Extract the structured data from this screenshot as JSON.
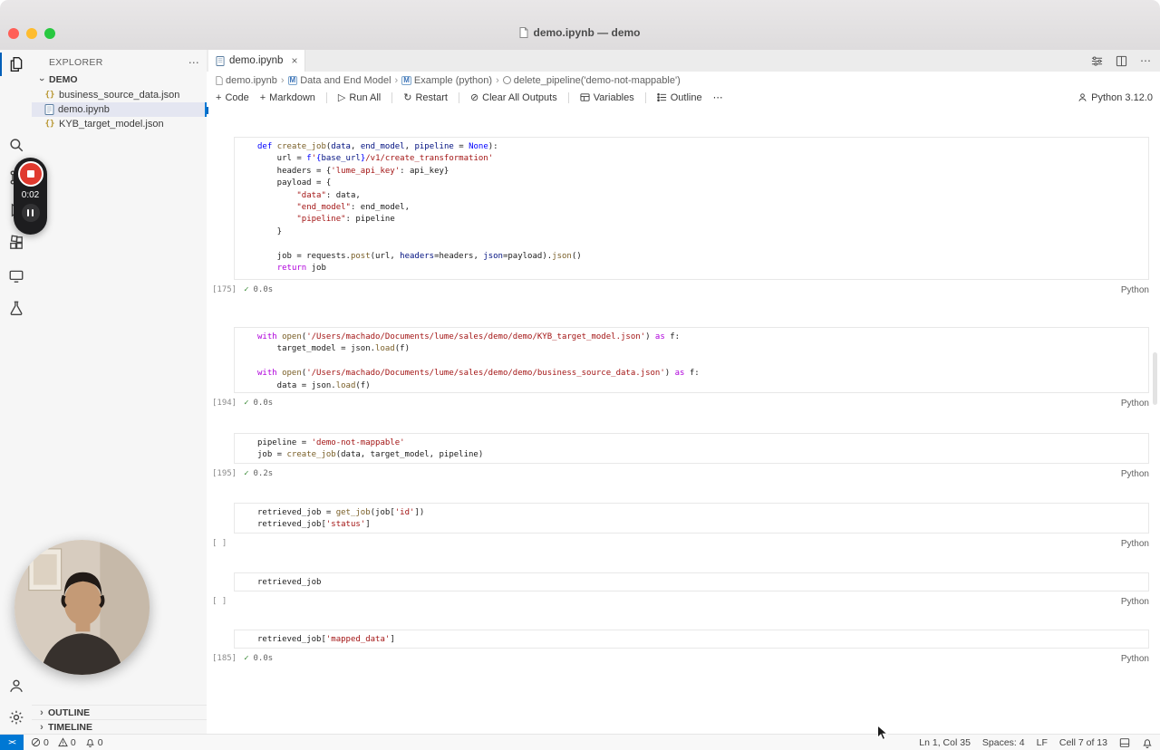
{
  "window": {
    "title": "demo.ipynb — demo"
  },
  "tab": {
    "label": "demo.ipynb",
    "close": "×"
  },
  "editor_actions": {
    "more": "⋯"
  },
  "breadcrumbs": {
    "separator": "›",
    "items": [
      {
        "label": "demo.ipynb"
      },
      {
        "label": "Data and End Model"
      },
      {
        "label": "Example (python)"
      },
      {
        "label": "delete_pipeline('demo-not-mappable')"
      }
    ]
  },
  "toolbar": {
    "code": "Code",
    "markdown": "Markdown",
    "run_all": "Run All",
    "restart": "Restart",
    "clear_outputs": "Clear All Outputs",
    "variables": "Variables",
    "outline": "Outline",
    "more": "⋯",
    "kernel": "Python 3.12.0"
  },
  "explorer": {
    "title": "EXPLORER",
    "actions": "⋯",
    "section": "DEMO",
    "files": [
      {
        "name": "business_source_data.json",
        "type": "json"
      },
      {
        "name": "demo.ipynb",
        "type": "notebook",
        "selected": true
      },
      {
        "name": "KYB_target_model.json",
        "type": "json"
      }
    ],
    "outline": "OUTLINE",
    "timeline": "TIMELINE"
  },
  "recorder": {
    "time": "0:02"
  },
  "token_colors": {
    "kw": "#0000ff",
    "ctl": "#af00db",
    "fn": "#795e26",
    "str": "#a31515",
    "pm": "#001080",
    "fg": "#1b1b1b"
  },
  "cells": [
    {
      "exec": "[175]",
      "success": true,
      "duration": "0.0s",
      "lang": "Python",
      "lines": [
        [
          [
            "kw",
            "def "
          ],
          [
            "fn",
            "create_job"
          ],
          [
            "fg",
            "("
          ],
          [
            "pm",
            "data"
          ],
          [
            "fg",
            ", "
          ],
          [
            "pm",
            "end_model"
          ],
          [
            "fg",
            ", "
          ],
          [
            "pm",
            "pipeline"
          ],
          [
            "fg",
            " = "
          ],
          [
            "kw",
            "None"
          ],
          [
            "fg",
            "):"
          ]
        ],
        [
          [
            "fg",
            "    url = "
          ],
          [
            "kw",
            "f"
          ],
          [
            "str",
            "'"
          ],
          [
            "kw",
            "{"
          ],
          [
            "pm",
            "base_url"
          ],
          [
            "kw",
            "}"
          ],
          [
            "str",
            "/v1/create_transformation'"
          ]
        ],
        [
          [
            "fg",
            "    headers = {"
          ],
          [
            "str",
            "'lume_api_key'"
          ],
          [
            "fg",
            ": api_key}"
          ]
        ],
        [
          [
            "fg",
            "    payload = {"
          ]
        ],
        [
          [
            "fg",
            "        "
          ],
          [
            "str",
            "\"data\""
          ],
          [
            "fg",
            ": data,"
          ]
        ],
        [
          [
            "fg",
            "        "
          ],
          [
            "str",
            "\"end_model\""
          ],
          [
            "fg",
            ": end_model,"
          ]
        ],
        [
          [
            "fg",
            "        "
          ],
          [
            "str",
            "\"pipeline\""
          ],
          [
            "fg",
            ": pipeline"
          ]
        ],
        [
          [
            "fg",
            "    }"
          ]
        ],
        [],
        [
          [
            "fg",
            "    job = requests."
          ],
          [
            "fn",
            "post"
          ],
          [
            "fg",
            "(url, "
          ],
          [
            "pm",
            "headers"
          ],
          [
            "fg",
            "=headers, "
          ],
          [
            "pm",
            "json"
          ],
          [
            "fg",
            "=payload)."
          ],
          [
            "fn",
            "json"
          ],
          [
            "fg",
            "()"
          ]
        ],
        [
          [
            "fg",
            "    "
          ],
          [
            "ctl",
            "return"
          ],
          [
            "fg",
            " job"
          ]
        ]
      ]
    },
    {
      "exec": "[194]",
      "success": true,
      "duration": "0.0s",
      "lang": "Python",
      "lines": [
        [
          [
            "ctl",
            "with "
          ],
          [
            "fn",
            "open"
          ],
          [
            "fg",
            "("
          ],
          [
            "str",
            "'/Users/machado/Documents/lume/sales/demo/demo/KYB_target_model.json'"
          ],
          [
            "fg",
            ")"
          ],
          [
            "ctl",
            " as "
          ],
          [
            "fg",
            "f:"
          ]
        ],
        [
          [
            "fg",
            "    target_model = json."
          ],
          [
            "fn",
            "load"
          ],
          [
            "fg",
            "(f)"
          ]
        ],
        [],
        [
          [
            "ctl",
            "with "
          ],
          [
            "fn",
            "open"
          ],
          [
            "fg",
            "("
          ],
          [
            "str",
            "'/Users/machado/Documents/lume/sales/demo/demo/business_source_data.json'"
          ],
          [
            "fg",
            ")"
          ],
          [
            "ctl",
            " as "
          ],
          [
            "fg",
            "f:"
          ]
        ],
        [
          [
            "fg",
            "    data = json."
          ],
          [
            "fn",
            "load"
          ],
          [
            "fg",
            "(f)"
          ]
        ]
      ]
    },
    {
      "exec": "[195]",
      "success": true,
      "duration": "0.2s",
      "lang": "Python",
      "lines": [
        [
          [
            "fg",
            "pipeline = "
          ],
          [
            "str",
            "'demo-not-mappable'"
          ]
        ],
        [
          [
            "fg",
            "job = "
          ],
          [
            "fn",
            "create_job"
          ],
          [
            "fg",
            "(data, target_model, pipeline)"
          ]
        ]
      ]
    },
    {
      "exec": "[ ]",
      "success": false,
      "duration": "",
      "lang": "Python",
      "lines": [
        [
          [
            "fg",
            "retrieved_job = "
          ],
          [
            "fn",
            "get_job"
          ],
          [
            "fg",
            "(job["
          ],
          [
            "str",
            "'id'"
          ],
          [
            "fg",
            "])"
          ]
        ],
        [
          [
            "fg",
            "retrieved_job["
          ],
          [
            "str",
            "'status'"
          ],
          [
            "fg",
            "]"
          ]
        ]
      ]
    },
    {
      "exec": "[ ]",
      "success": false,
      "duration": "",
      "lang": "Python",
      "lines": [
        [
          [
            "fg",
            "retrieved_job"
          ]
        ]
      ]
    },
    {
      "exec": "[185]",
      "success": true,
      "duration": "0.0s",
      "lang": "Python",
      "lines": [
        [
          [
            "fg",
            "retrieved_job["
          ],
          [
            "str",
            "'mapped_data'"
          ],
          [
            "fg",
            "]"
          ]
        ]
      ]
    }
  ],
  "statusbar": {
    "errors": "0",
    "warnings": "0",
    "bell_count": "0",
    "cursor": "Ln 1, Col 35",
    "spaces": "Spaces: 4",
    "eol": "LF",
    "cell_pos": "Cell 7 of 13"
  }
}
